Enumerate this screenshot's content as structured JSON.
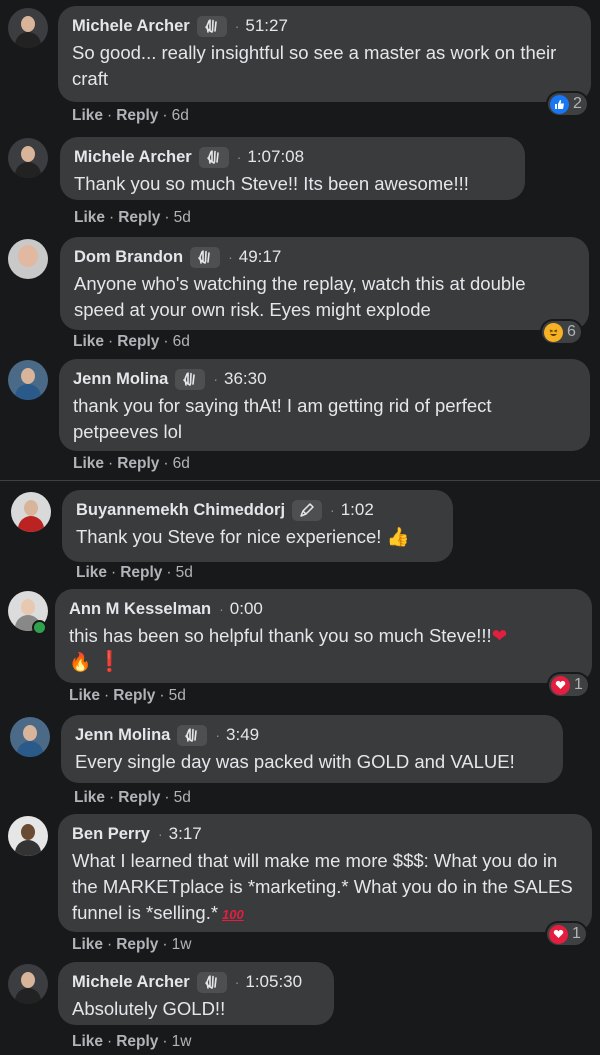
{
  "comments": [
    {
      "name": "Michele Archer",
      "badge": "wave-icon",
      "time": "51:27",
      "text": "So good... really insightful so see a master as work on their craft",
      "like": "Like",
      "reply": "Reply",
      "age": "6d",
      "reaction": {
        "icon": "like-icon",
        "count": "2"
      }
    },
    {
      "name": "Michele Archer",
      "badge": "wave-icon",
      "time": "1:07:08",
      "text": "Thank you so much Steve!! Its been awesome!!!",
      "like": "Like",
      "reply": "Reply",
      "age": "5d"
    },
    {
      "name": "Dom Brandon",
      "badge": "wave-icon",
      "time": "49:17",
      "text": "Anyone who's watching the replay, watch this at double speed at your own risk. Eyes might explode",
      "like": "Like",
      "reply": "Reply",
      "age": "6d",
      "reaction": {
        "icon": "haha-icon",
        "count": "6"
      }
    },
    {
      "name": "Jenn Molina",
      "badge": "wave-icon",
      "time": "36:30",
      "text": "thank you for saying thAt! I am getting rid of perfect petpeeves lol",
      "like": "Like",
      "reply": "Reply",
      "age": "6d"
    },
    {
      "name": "Buyannemekh Chimeddorj",
      "badge": "pen-icon",
      "time": "1:02",
      "text": "Thank you Steve for nice experience!",
      "trailing_emoji": "👍",
      "like": "Like",
      "reply": "Reply",
      "age": "5d"
    },
    {
      "name": "Ann M Kesselman",
      "time": "0:00",
      "text": "this has been so helpful thank you so much Steve!!!",
      "trailing_emoji": "❤",
      "extra_emojis": [
        "🔥",
        "❗"
      ],
      "like": "Like",
      "reply": "Reply",
      "age": "5d",
      "reaction": {
        "icon": "love-icon",
        "count": "1"
      }
    },
    {
      "name": "Jenn Molina",
      "badge": "wave-icon",
      "time": "3:49",
      "text": "Every single day was packed with GOLD and VALUE!",
      "like": "Like",
      "reply": "Reply",
      "age": "5d"
    },
    {
      "name": "Ben Perry",
      "time": "3:17",
      "text": "What I learned that will make me more $$$: What you do in the MARKETplace is *marketing.* What you do in the SALES funnel is *selling.*",
      "trailing_emoji": "100",
      "like": "Like",
      "reply": "Reply",
      "age": "1w",
      "reaction": {
        "icon": "love-icon",
        "count": "1"
      }
    },
    {
      "name": "Michele Archer",
      "badge": "wave-icon",
      "time": "1:05:30",
      "text": "Absolutely GOLD!!",
      "like": "Like",
      "reply": "Reply",
      "age": "1w"
    }
  ],
  "colors": {
    "background": "#18191a",
    "bubble": "#3a3b3c",
    "like_blue": "#1877f2",
    "love_red": "#e41e3f",
    "haha_yellow": "#f7b125"
  }
}
